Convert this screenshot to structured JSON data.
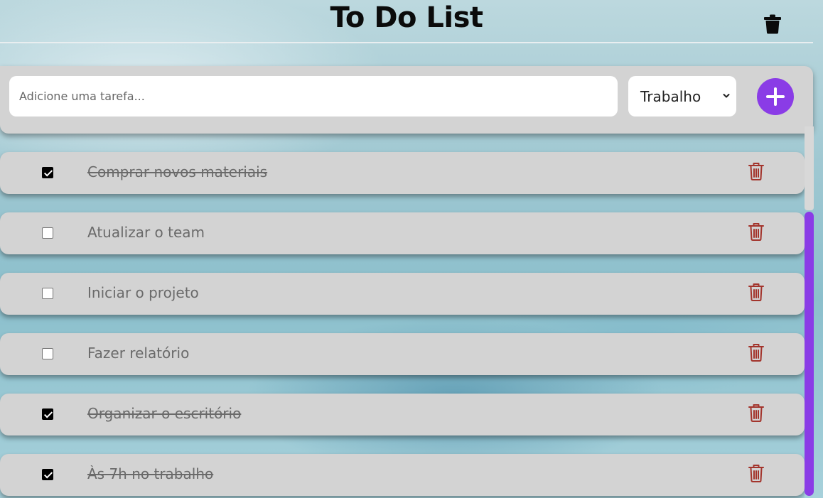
{
  "header": {
    "title": "To Do List",
    "clear_icon": "trash-icon"
  },
  "form": {
    "placeholder": "Adicione uma tarefa...",
    "category_selected": "Trabalho",
    "add_icon": "plus-icon"
  },
  "tasks": [
    {
      "text": "Comprar novos materiais",
      "done": true
    },
    {
      "text": "Atualizar o team",
      "done": false
    },
    {
      "text": "Iniciar o projeto",
      "done": false
    },
    {
      "text": "Fazer relatório",
      "done": false
    },
    {
      "text": "Organizar o escritório",
      "done": true
    },
    {
      "text": "Às 7h no trabalho",
      "done": true
    }
  ],
  "colors": {
    "accent": "#8a3ce6",
    "delete": "#a3342c",
    "card": "#d3d3d3"
  },
  "scroll": {
    "position_fraction": 0.23
  }
}
